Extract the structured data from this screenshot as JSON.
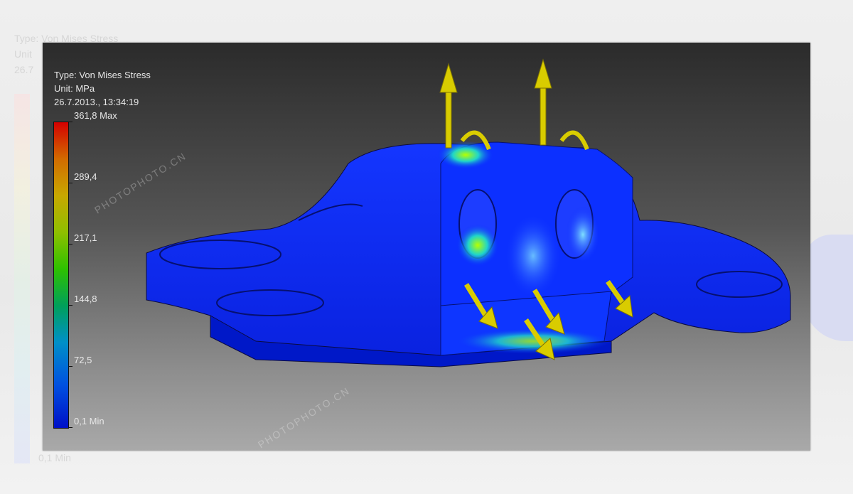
{
  "legend": {
    "type": "Type: Von Mises Stress",
    "unit": "Unit: MPa",
    "timestamp": "26.7.2013., 13:34:19",
    "labels": [
      {
        "text": "361,8 Max",
        "value": 361.8
      },
      {
        "text": "289,4",
        "value": 289.4
      },
      {
        "text": "217,1",
        "value": 217.1
      },
      {
        "text": "144,8",
        "value": 144.8
      },
      {
        "text": "72,5",
        "value": 72.5
      },
      {
        "text": "0,1 Min",
        "value": 0.1
      }
    ]
  },
  "ghost": {
    "type": "Type: Von Mises Stress",
    "unit": "Unit",
    "timestamp": "26.7",
    "min": "0,1 Min"
  },
  "watermark": {
    "text": "PHOTOPHOTO.CN"
  },
  "colors": {
    "part": "#0a2bff",
    "arrow": "#d9cc00",
    "max": "#d40000",
    "min": "#0010c8"
  }
}
